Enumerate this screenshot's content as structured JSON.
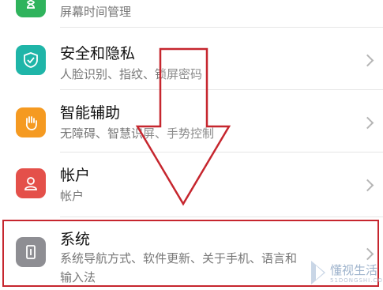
{
  "rows": [
    {
      "title": "",
      "subtitle": "屏幕时间管理",
      "color": "#2fb35c",
      "icon": "hourglass-icon"
    },
    {
      "title": "安全和隐私",
      "subtitle": "人脸识别、指纹、锁屏密码",
      "color": "#1fb5a8",
      "icon": "shield-check-icon"
    },
    {
      "title": "智能辅助",
      "subtitle": "无障碍、智慧识屏、手势控制",
      "color": "#f59a21",
      "icon": "hand-icon"
    },
    {
      "title": "帐户",
      "subtitle": "帐户",
      "color": "#e4504a",
      "icon": "person-icon"
    },
    {
      "title": "系统",
      "subtitle": "系统导航方式、软件更新、关于手机、语言和",
      "subtitle2": "输入法",
      "color": "#8e8e93",
      "icon": "phone-info-icon"
    }
  ],
  "annotation": {
    "highlight_color": "#c6262e",
    "arrow_color": "#c6262e"
  },
  "watermark": {
    "text": "懂视生活",
    "sub": "51DONGSHI.COM"
  }
}
